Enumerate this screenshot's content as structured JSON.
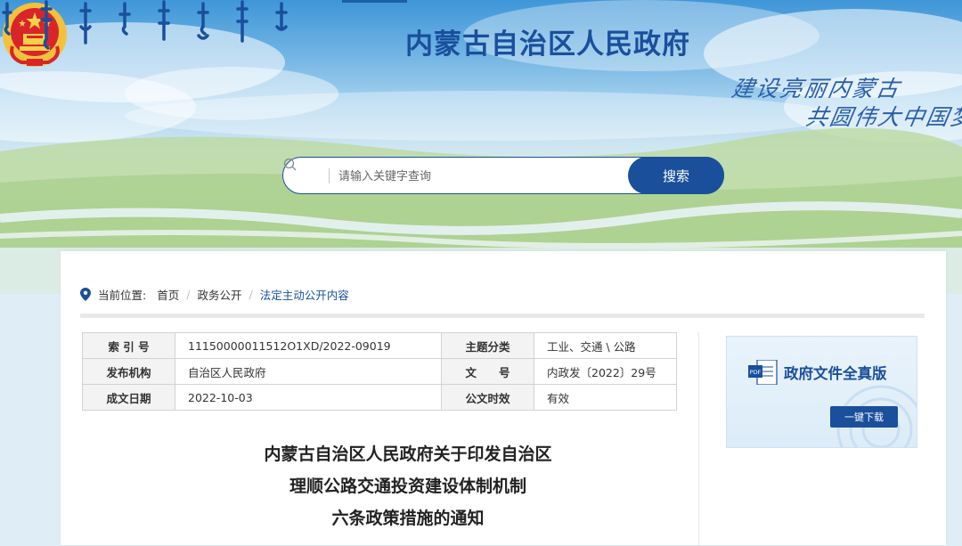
{
  "header": {
    "site_title": "内蒙古自治区人民政府",
    "slogan_line1": "建设亮丽内蒙古",
    "slogan_line2": "共圆伟大中国梦"
  },
  "search": {
    "placeholder": "请输入关键字查询",
    "button_label": "搜索"
  },
  "breadcrumb": {
    "label": "当前位置:",
    "items": [
      "首页",
      "政务公开",
      "法定主动公开内容"
    ]
  },
  "info_table": {
    "rows": [
      {
        "label1": "索 引 号",
        "value1": "11150000011512O1XD/2022-09019",
        "label2": "主题分类",
        "value2": "工业、交通 \\ 公路"
      },
      {
        "label1": "发布机构",
        "value1": "自治区人民政府",
        "label2": "文　　号",
        "value2": "内政发〔2022〕29号"
      },
      {
        "label1": "成文日期",
        "value1": "2022-10-03",
        "label2": "公文时效",
        "value2": "有效"
      }
    ]
  },
  "pdf_card": {
    "icon_text": "PDF",
    "title": "政府文件全真版",
    "download_label": "一键下载"
  },
  "document": {
    "title_lines": [
      "内蒙古自治区人民政府关于印发自治区",
      "理顺公路交通投资建设体制机制",
      "六条政策措施的通知"
    ]
  },
  "colors": {
    "brand": "#1a4f9c",
    "title": "#1a4f9c"
  }
}
